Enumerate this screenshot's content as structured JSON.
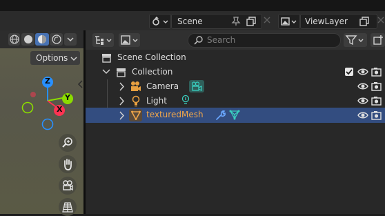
{
  "topbar": {
    "scene_name": "Scene",
    "view_layer_name": "ViewLayer"
  },
  "viewport": {
    "options_label": "Options",
    "gizmo": {
      "x_label": "X",
      "y_label": "Y",
      "z_label": "Z"
    }
  },
  "outliner": {
    "search_placeholder": "Search",
    "scene_collection_label": "Scene Collection",
    "collection_label": "Collection",
    "items": [
      {
        "label": "Camera",
        "icon": "camera-icon",
        "data_icon": "camera-data-icon",
        "selected": false
      },
      {
        "label": "Light",
        "icon": "light-icon",
        "data_icon": "light-data-icon",
        "selected": false
      },
      {
        "label": "texturedMesh",
        "icon": "mesh-object-icon",
        "data_icon": "mesh-data-icon",
        "modifier_icon": "wrench-icon",
        "selected": true
      }
    ]
  },
  "colors": {
    "selected_row": "#334d80",
    "selected_text": "#f0a64a",
    "gizmo_x": "#ff3352",
    "gizmo_y": "#8bdc00",
    "gizmo_z": "#2890ff"
  }
}
